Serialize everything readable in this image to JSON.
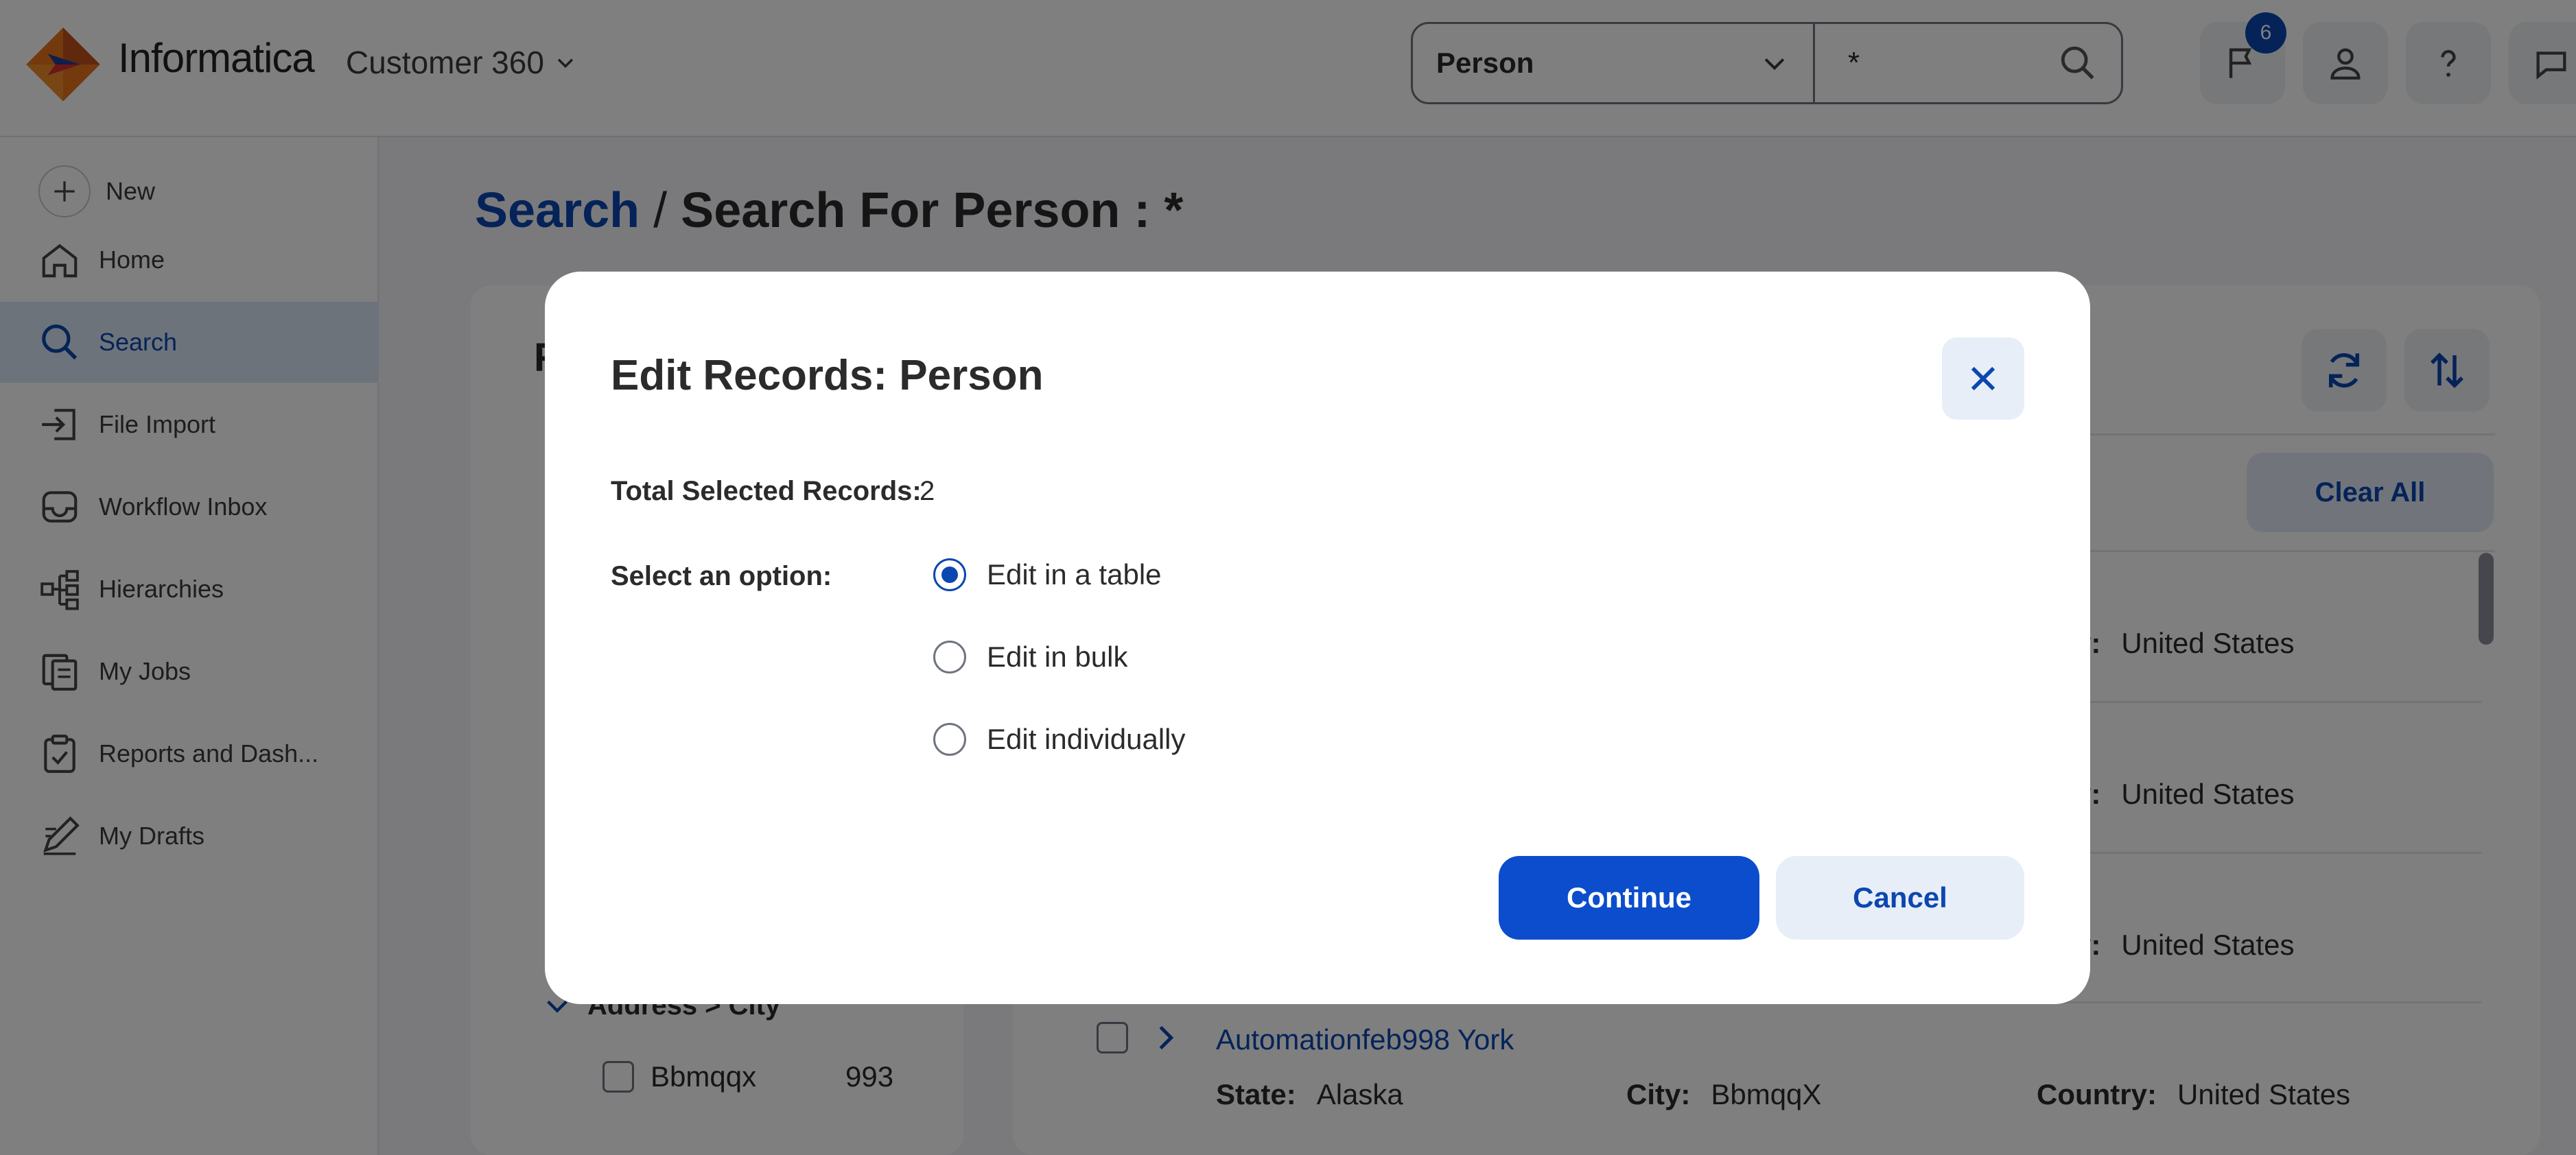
{
  "header": {
    "brand": "Informatica",
    "product": "Customer 360",
    "search": {
      "entity": "Person",
      "query": "*"
    },
    "notification_count": "6"
  },
  "sidebar": {
    "new_label": "New",
    "items": [
      {
        "label": "Home",
        "icon": "home-icon"
      },
      {
        "label": "Search",
        "icon": "search-icon"
      },
      {
        "label": "File Import",
        "icon": "file-import-icon"
      },
      {
        "label": "Workflow Inbox",
        "icon": "inbox-icon"
      },
      {
        "label": "Hierarchies",
        "icon": "hierarchy-icon"
      },
      {
        "label": "My Jobs",
        "icon": "jobs-icon"
      },
      {
        "label": "Reports and Dash...",
        "icon": "reports-icon"
      },
      {
        "label": "My Drafts",
        "icon": "drafts-icon"
      }
    ]
  },
  "breadcrumb": {
    "link": "Search",
    "separator": "/",
    "current": "Search For Person : *"
  },
  "facets": {
    "panel_letter": "F",
    "group_title": "Address > City",
    "items": [
      {
        "label": "Bbmqqx",
        "count": "993"
      }
    ]
  },
  "results": {
    "clear_all": "Clear All",
    "country_label": "ntry:",
    "country_values": [
      "United States",
      "United States",
      "United States"
    ],
    "last_record": {
      "name": "Automationfeb998 York",
      "state_label": "State:",
      "state": "Alaska",
      "city_label": "City:",
      "city": "BbmqqX",
      "country_label": "Country:",
      "country": "United States"
    }
  },
  "modal": {
    "title": "Edit Records: Person",
    "total_label": "Total Selected Records:",
    "total_value": "2",
    "option_label": "Select an option:",
    "options": [
      "Edit in a table",
      "Edit in bulk",
      "Edit individually"
    ],
    "selected_option": "Edit in a table",
    "continue_label": "Continue",
    "cancel_label": "Cancel"
  },
  "colors": {
    "accent": "#0b47b0",
    "primary_button": "#0b4dcc",
    "active_nav_bg": "#dbe6f7",
    "overlay": "rgba(0,0,0,0.5)"
  }
}
